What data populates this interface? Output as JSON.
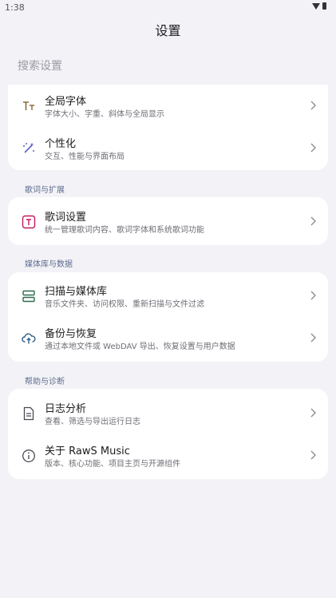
{
  "status": {
    "time": "1:38"
  },
  "app_bar": {
    "title": "设置"
  },
  "search": {
    "placeholder": "搜索设置"
  },
  "sections": {
    "general": {
      "items": [
        {
          "title": "全局字体",
          "subtitle": "字体大小、字重、斜体与全局显示",
          "icon": "font-size-icon"
        },
        {
          "title": "个性化",
          "subtitle": "交互、性能与界面布局",
          "icon": "magic-wand-icon"
        }
      ]
    },
    "lyrics": {
      "label": "歌词与扩展",
      "items": [
        {
          "title": "歌词设置",
          "subtitle": "统一管理歌词内容、歌词字体和系统歌词功能",
          "icon": "lyrics-icon"
        }
      ]
    },
    "media": {
      "label": "媒体库与数据",
      "items": [
        {
          "title": "扫描与媒体库",
          "subtitle": "音乐文件夹、访问权限、重新扫描与文件过滤",
          "icon": "scan-icon"
        },
        {
          "title": "备份与恢复",
          "subtitle": "通过本地文件或 WebDAV 导出、恢复设置与用户数据",
          "icon": "cloud-upload-icon"
        }
      ]
    },
    "help": {
      "label": "帮助与诊断",
      "items": [
        {
          "title": "日志分析",
          "subtitle": "查看、筛选与导出运行日志",
          "icon": "document-icon"
        },
        {
          "title": "关于 RawS Music",
          "subtitle": "版本、核心功能、项目主页与开源组件",
          "icon": "info-icon"
        }
      ]
    }
  },
  "colors": {
    "background": "#f3f3f7",
    "card": "#ffffff",
    "accent_font": "#8a6a3a",
    "accent_magic": "#5b5fc7",
    "accent_lyrics": "#c2185b",
    "accent_scan": "#2e6b4f",
    "accent_cloud": "#2b5f8a",
    "section_label": "#5f6b8f"
  }
}
